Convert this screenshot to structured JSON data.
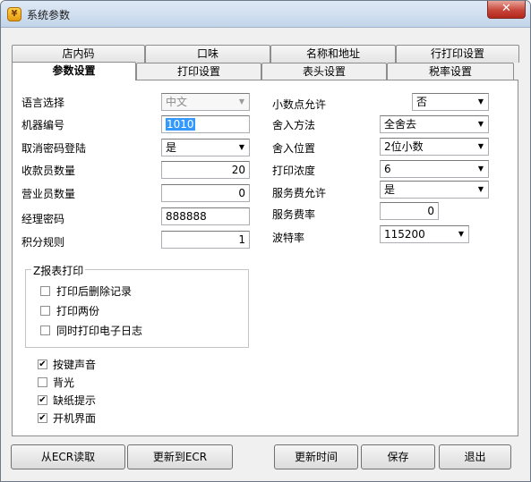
{
  "window": {
    "title": "系统参数",
    "app_icon": "app-icon",
    "close_icon": "close-icon"
  },
  "tabs": {
    "back_row": [
      "店内码",
      "口味",
      "名称和地址",
      "行打印设置"
    ],
    "front_row": [
      "参数设置",
      "打印设置",
      "表头设置",
      "税率设置"
    ],
    "active": "参数设置"
  },
  "left_fields": [
    {
      "label": "语言选择",
      "type": "select",
      "value": "中文",
      "disabled": true
    },
    {
      "label": "机器编号",
      "type": "input",
      "value": "1010",
      "selected": true
    },
    {
      "label": "取消密码登陆",
      "type": "select",
      "value": "是"
    },
    {
      "label": "收款员数量",
      "type": "number",
      "value": "20"
    },
    {
      "label": "营业员数量",
      "type": "number",
      "value": "0"
    },
    {
      "label": "经理密码",
      "type": "input",
      "value": "888888"
    },
    {
      "label": "积分规则",
      "type": "number",
      "value": "1"
    }
  ],
  "right_fields": [
    {
      "label": "小数点允许",
      "type": "select",
      "value": "否"
    },
    {
      "label": "舍入方法",
      "type": "select",
      "value": "全舍去"
    },
    {
      "label": "舍入位置",
      "type": "select",
      "value": "2位小数"
    },
    {
      "label": "打印浓度",
      "type": "select",
      "value": "6"
    },
    {
      "label": "服务费允许",
      "type": "select",
      "value": "是"
    },
    {
      "label": "服务费率",
      "type": "number",
      "value": "0"
    },
    {
      "label": "波特率",
      "type": "select",
      "value": "115200"
    }
  ],
  "z_report": {
    "title": "Z报表打印",
    "options": [
      {
        "label": "打印后删除记录",
        "checked": false
      },
      {
        "label": "打印两份",
        "checked": false
      },
      {
        "label": "同时打印电子日志",
        "checked": false
      }
    ]
  },
  "options": [
    {
      "label": "按键声音",
      "checked": true
    },
    {
      "label": "背光",
      "checked": false
    },
    {
      "label": "缺纸提示",
      "checked": true
    },
    {
      "label": "开机界面",
      "checked": true
    }
  ],
  "buttons": {
    "read_from_ecr": "从ECR读取",
    "update_to_ecr": "更新到ECR",
    "update_time": "更新时间",
    "save": "保存",
    "exit": "退出"
  }
}
